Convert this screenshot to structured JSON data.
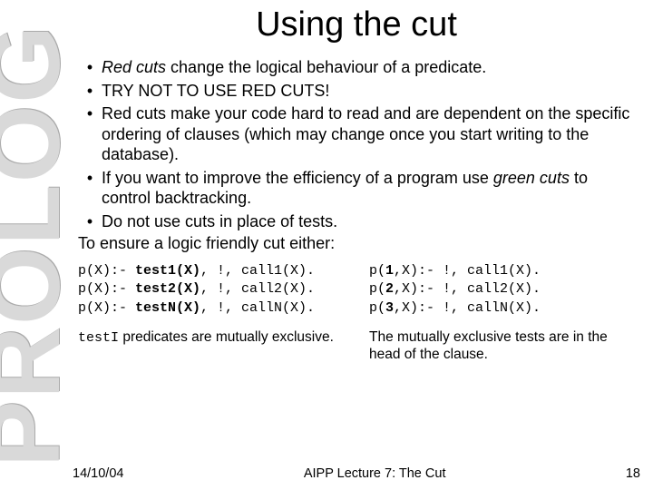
{
  "side_label": "PROLOG",
  "title": "Using the cut",
  "bullets": [
    {
      "pre": "",
      "em": "Red cuts",
      "post": " change the logical behaviour of a predicate."
    },
    {
      "pre": "TRY NOT TO USE RED CUTS!",
      "em": "",
      "post": ""
    },
    {
      "pre": "Red cuts make your code hard to read and are dependent on the specific ordering of clauses (which may change once you start writing to the database).",
      "em": "",
      "post": ""
    },
    {
      "pre": "If you want to improve the efficiency of a program use ",
      "em": "green cuts",
      "post": " to control backtracking."
    },
    {
      "pre": "Do not use cuts in place of tests.",
      "em": "",
      "post": ""
    }
  ],
  "ensure": "To ensure a logic friendly cut either:",
  "left_code": {
    "l1a": "p(X):- ",
    "l1b": "test1(X)",
    "l1c": ", !, call1(X).",
    "l2a": "p(X):- ",
    "l2b": "test2(X)",
    "l2c": ", !, call2(X).",
    "l3a": "p(X):- ",
    "l3b": "testN(X)",
    "l3c": ", !, callN(X)."
  },
  "right_code": {
    "r1a": "p(",
    "r1b": "1",
    "r1c": ",X):- !, call1(X).",
    "r2a": "p(",
    "r2b": "2",
    "r2c": ",X):- !, call2(X).",
    "r3a": "p(",
    "r3b": "3",
    "r3c": ",X):- !, callN(X)."
  },
  "left_note_code": "testI",
  "left_note_rest": " predicates are mutually exclusive.",
  "right_note": "The mutually exclusive tests are in the head of the clause.",
  "footer": {
    "date": "14/10/04",
    "lecture": "AIPP Lecture 7: The Cut",
    "page": "18"
  }
}
